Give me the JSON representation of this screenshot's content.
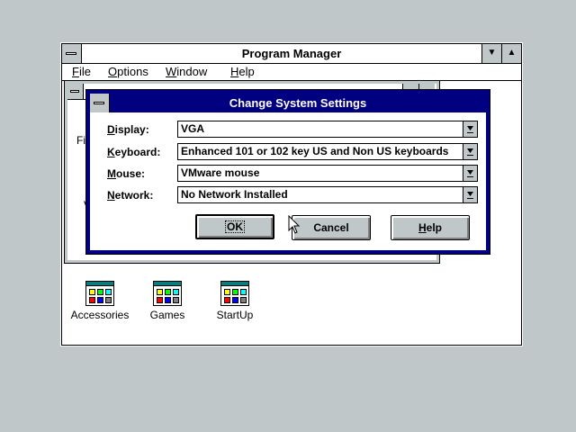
{
  "program_manager": {
    "title": "Program Manager",
    "menu": {
      "file": {
        "hot": "F",
        "rest": "ile"
      },
      "options": {
        "hot": "O",
        "rest": "ptions"
      },
      "window": {
        "hot": "W",
        "rest": "indow"
      },
      "help": {
        "hot": "H",
        "rest": "elp"
      }
    },
    "minimize_glyph": "▼",
    "maximize_glyph": "▲"
  },
  "main_group": {
    "peek_file": "Fil",
    "peek_v": "V"
  },
  "groups": [
    {
      "label": "Accessories"
    },
    {
      "label": "Games"
    },
    {
      "label": "StartUp"
    }
  ],
  "dialog": {
    "title": "Change System Settings",
    "fields": {
      "display": {
        "hot": "D",
        "rest": "isplay:",
        "value": "VGA"
      },
      "keyboard": {
        "hot": "K",
        "rest": "eyboard:",
        "value": "Enhanced 101 or 102 key US and Non US keyboards"
      },
      "mouse": {
        "hot": "M",
        "rest": "ouse:",
        "value": "VMware mouse"
      },
      "network": {
        "hot": "N",
        "rest": "etwork:",
        "value": "No Network Installed"
      }
    },
    "buttons": {
      "ok": {
        "label": "OK"
      },
      "cancel": {
        "label": "Cancel"
      },
      "help": {
        "hot": "H",
        "rest": "elp"
      }
    }
  },
  "colors": {
    "desktop": "#c0c7c8",
    "active_title": "#000080",
    "button_face": "#c0c7c8",
    "group_icon_accent": "#008080"
  }
}
